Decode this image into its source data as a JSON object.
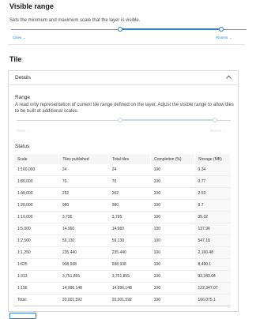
{
  "visible_range": {
    "title": "Visible range",
    "description": "Sets the minimum and maximum scale that the layer is visible.",
    "min_label": "Cities",
    "max_label": "Rooms"
  },
  "tile": {
    "title": "Tile",
    "details": {
      "title": "Details",
      "range_title": "Range",
      "range_description": "A read only representation of current tile range defined on the layer. Adjust the visible range to allow tiles to be built at additional scales.",
      "range_min_label": "Cities",
      "range_max_label": "Rooms",
      "status_title": "Status",
      "table": {
        "headers": [
          "Scale",
          "Tiles published",
          "Total tiles",
          "Completion (%)",
          "Storage (MB)"
        ],
        "rows": [
          [
            "1:160,000",
            "24",
            "24",
            "100",
            "0.34"
          ],
          [
            "1:80,000",
            "70",
            "70",
            "100",
            "0.77"
          ],
          [
            "1:40,000",
            "252",
            "252",
            "100",
            "2.53"
          ],
          [
            "1:20,000",
            "980",
            "980",
            "100",
            "9.7"
          ],
          [
            "1:10,000",
            "3,795",
            "3,795",
            "100",
            "35.32"
          ],
          [
            "1:5,000",
            "14,960",
            "14,960",
            "100",
            "137.96"
          ],
          [
            "1:2,500",
            "59,130",
            "59,130",
            "100",
            "547.18"
          ],
          [
            "1:1,250",
            "235,440",
            "235,440",
            "100",
            "2,160.48"
          ],
          [
            "1:625",
            "938,938",
            "938,938",
            "100",
            "8,490.1"
          ],
          [
            "1:313",
            "3,751,855",
            "3,751,855",
            "100",
            "32,343.64"
          ],
          [
            "1:156",
            "14,996,148",
            "14,996,148",
            "100",
            "122,347.07"
          ]
        ],
        "total": [
          "Total:",
          "20,001,592",
          "20,001,592",
          "100",
          "166,075.1"
        ]
      }
    }
  },
  "icons": {
    "chevron_down": "chevron-down-icon",
    "chevron_up": "chevron-up-icon"
  },
  "colors": {
    "accent": "#2e7bd1",
    "disabled": "#c7d7ea"
  }
}
